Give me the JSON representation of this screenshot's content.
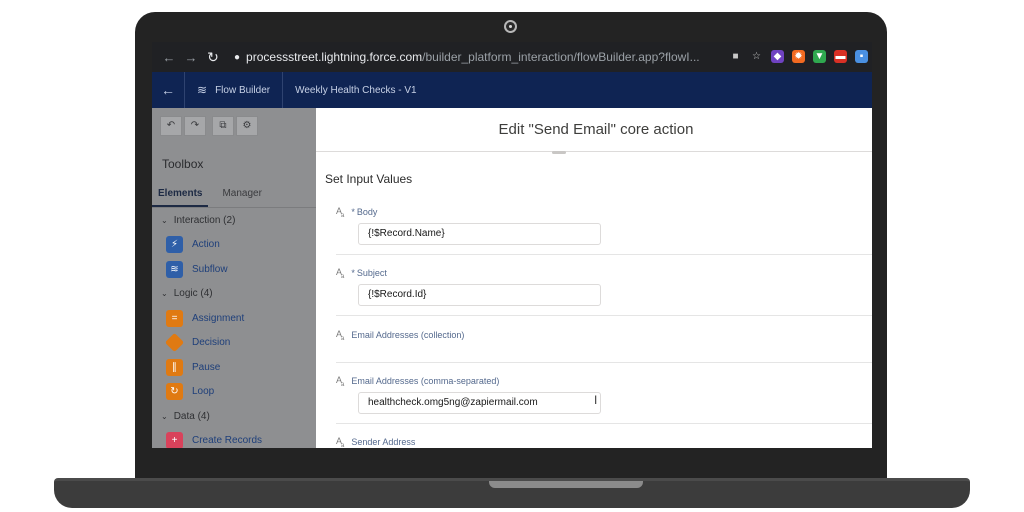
{
  "browser": {
    "url_host": "processstreet.lightning.force.com",
    "url_path": "/builder_platform_interaction/flowBuilder.app?flowI..."
  },
  "header": {
    "app_name": "Flow Builder",
    "flow_title": "Weekly Health Checks - V1"
  },
  "toolbox": {
    "title": "Toolbox",
    "tabs": [
      "Elements",
      "Manager"
    ],
    "sections": [
      {
        "label": "Interaction (2)",
        "items": [
          {
            "label": "Action",
            "color": "#2f5fa8"
          },
          {
            "label": "Subflow",
            "color": "#2f5fa8"
          }
        ]
      },
      {
        "label": "Logic (4)",
        "items": [
          {
            "label": "Assignment",
            "color": "#e07a12"
          },
          {
            "label": "Decision",
            "color": "#e07a12"
          },
          {
            "label": "Pause",
            "color": "#e07a12"
          },
          {
            "label": "Loop",
            "color": "#e07a12"
          }
        ]
      },
      {
        "label": "Data (4)",
        "items": [
          {
            "label": "Create Records",
            "color": "#d9425b"
          }
        ]
      }
    ]
  },
  "modal": {
    "title": "Edit \"Send Email\" core action",
    "section_title": "Set Input Values",
    "fields": [
      {
        "label": "Body",
        "required": "*",
        "value": "{!$Record.Name}"
      },
      {
        "label": "Subject",
        "required": "*",
        "value": "{!$Record.Id}"
      },
      {
        "label": "Email Addresses (collection)"
      },
      {
        "label": "Email Addresses (comma-separated)",
        "value": "healthcheck.omg5ng@zapiermail.com"
      },
      {
        "label": "Sender Address"
      }
    ]
  }
}
